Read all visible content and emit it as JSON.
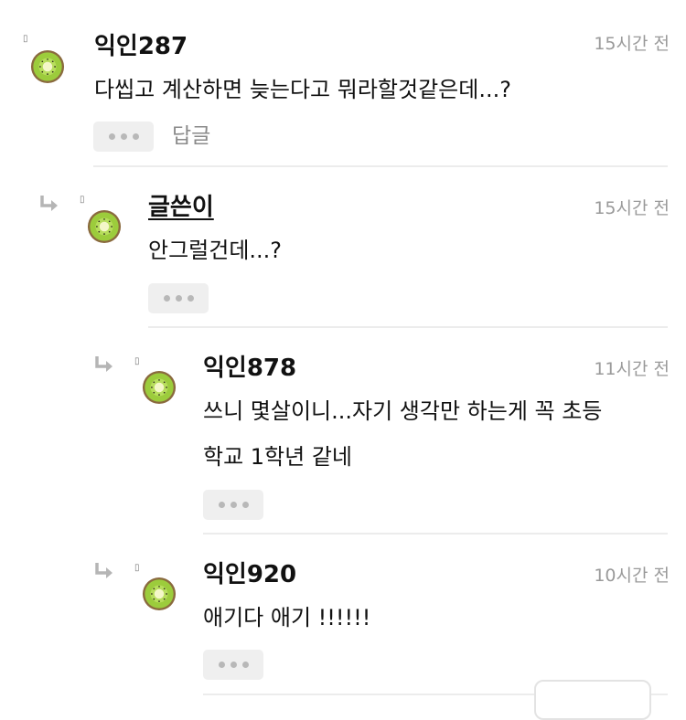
{
  "comments": [
    {
      "author": "익인287",
      "time": "15시간 전",
      "lines": [
        "다씹고 계산하면 늦는다고 뭐라할것같은데...?"
      ],
      "reply_label": "답글"
    },
    {
      "author": "글쓴이",
      "time": "15시간 전",
      "lines": [
        "안그럴건데...?"
      ]
    },
    {
      "author": "익인878",
      "time": "11시간 전",
      "lines": [
        "쓰니 몇살이니...자기 생각만 하는게 꼭 초등",
        "학교 1학년 같네"
      ]
    },
    {
      "author": "익인920",
      "time": "10시간 전",
      "lines": [
        "애기다 애기 !!!!!!"
      ]
    }
  ],
  "icons": {
    "avatar": "kiwi-icon",
    "reply_arrow": "reply-arrow-icon",
    "more": "more-dots-icon"
  },
  "colors": {
    "kiwi_skin": "#8a6a3e",
    "kiwi_flesh": "#9ccc3c",
    "kiwi_core": "#f4f7c8",
    "muted_text": "#9a9a9a",
    "button_bg": "#efefef"
  }
}
